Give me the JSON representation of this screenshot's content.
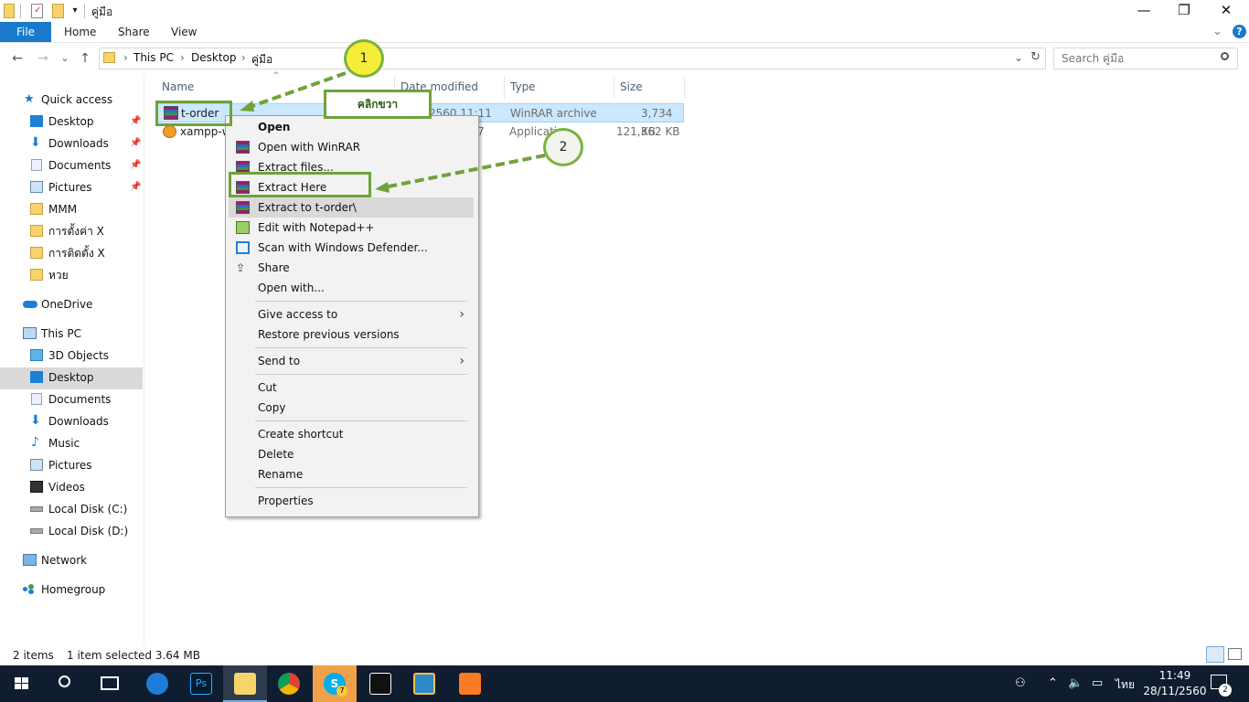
{
  "window": {
    "title": "คู่มือ",
    "quick_access_dropdown": "▾",
    "controls": {
      "minimize": "—",
      "restore": "❐",
      "close": "✕"
    }
  },
  "ribbon": {
    "tabs": [
      "File",
      "Home",
      "Share",
      "View"
    ],
    "expand": "⌄",
    "help": "?"
  },
  "address": {
    "back": "←",
    "forward": "→",
    "recent": "⌄",
    "up": "↑",
    "crumbs": [
      "This PC",
      "Desktop",
      "คู่มือ"
    ],
    "separator": "›",
    "dropdown": "⌄",
    "refresh": "↻"
  },
  "search": {
    "placeholder": "Search คู่มือ"
  },
  "nav": {
    "quick_access": "Quick access",
    "quick_items": [
      {
        "label": "Desktop",
        "pinned": true
      },
      {
        "label": "Downloads",
        "pinned": true
      },
      {
        "label": "Documents",
        "pinned": true
      },
      {
        "label": "Pictures",
        "pinned": true
      },
      {
        "label": "MMM",
        "pinned": false
      },
      {
        "label": "การตั้งค่า X",
        "pinned": false
      },
      {
        "label": "การติดตั้ง X",
        "pinned": false
      },
      {
        "label": "หวย",
        "pinned": false
      }
    ],
    "onedrive": "OneDrive",
    "this_pc": "This PC",
    "pc_items": [
      "3D Objects",
      "Desktop",
      "Documents",
      "Downloads",
      "Music",
      "Pictures",
      "Videos",
      "Local Disk (C:)",
      "Local Disk (D:)"
    ],
    "network": "Network",
    "homegroup": "Homegroup",
    "selected": "Desktop"
  },
  "filelist": {
    "columns": [
      "Name",
      "Date modified",
      "Type",
      "Size"
    ],
    "rows": [
      {
        "name": "t-order",
        "date": "2560 11:11",
        "type": "WinRAR archive",
        "size": "3,734 KB"
      },
      {
        "name": "xampp-w",
        "date": "7",
        "type": "Applicati",
        "size": "121,362 KB"
      }
    ]
  },
  "context_menu": {
    "items": [
      {
        "label": "Open",
        "bold": true
      },
      {
        "label": "Open with WinRAR"
      },
      {
        "label": "Extract files..."
      },
      {
        "label": "Extract Here"
      },
      {
        "label": "Extract to t-order\\"
      },
      {
        "label": "Edit with Notepad++"
      },
      {
        "label": "Scan with Windows Defender..."
      },
      {
        "label": "Share"
      },
      {
        "label": "Open with..."
      },
      {
        "label": "Give access to",
        "submenu": true
      },
      {
        "label": "Restore previous versions"
      },
      {
        "label": "Send to",
        "submenu": true
      },
      {
        "label": "Cut"
      },
      {
        "label": "Copy"
      },
      {
        "label": "Create shortcut"
      },
      {
        "label": "Delete"
      },
      {
        "label": "Rename"
      },
      {
        "label": "Properties"
      }
    ],
    "highlighted": "Extract to t-order\\",
    "submenu_arrow": "›"
  },
  "annotations": {
    "step1": "1",
    "step2": "2",
    "label": "คลิกขวา"
  },
  "status": {
    "count": "2 items",
    "selected": "1 item selected  3.64 MB"
  },
  "taskbar": {
    "time": "11:49",
    "date": "28/11/2560",
    "language": "ไทย",
    "notifications": "2",
    "skype_badge": "7",
    "colors": {
      "bg": "#101d31",
      "accent": "#1979ca"
    }
  }
}
